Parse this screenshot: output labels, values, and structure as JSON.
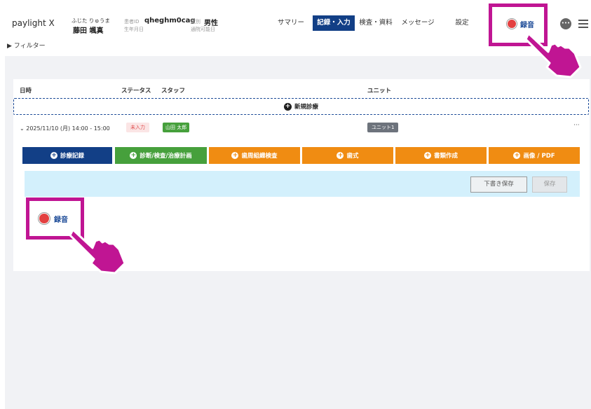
{
  "header": {
    "logo": "paylight X",
    "patient_kana": "ふじた りゅうま",
    "patient_name": "藤田 颯真",
    "patient_id_label": "患者ID",
    "patient_id": "qheghm0cag",
    "birth_label": "生年月日",
    "sex_label": "性別",
    "sex": "男性",
    "visit_label": "通院可能日"
  },
  "nav": {
    "items": [
      "サマリー",
      "記録・入力",
      "検査・資料",
      "メッセージ",
      "設定"
    ],
    "active": "記録・入力"
  },
  "record": {
    "label": "録音",
    "dot_color": "#e34040"
  },
  "more_icon": "ellipsis-icon",
  "menu_icon": "hamburger-menu-icon",
  "filter": {
    "label": "フィルター"
  },
  "table": {
    "headers": [
      "日時",
      "ステータス",
      "スタッフ",
      "ユニット"
    ],
    "new_diagnosis": "新規診療",
    "row": {
      "datetime": "2025/11/10 (月) 14:00 - 15:00",
      "status": "未入力",
      "staff": "山田 太郎",
      "unit": "ユニット1",
      "more": "···"
    }
  },
  "actions": [
    {
      "label": "診療記録",
      "color": "#123f86"
    },
    {
      "label": "診断/検査/治療計画",
      "color": "#46a03c"
    },
    {
      "label": "歯周組織検査",
      "color": "#f08c12"
    },
    {
      "label": "歯式",
      "color": "#f08c12"
    },
    {
      "label": "書類作成",
      "color": "#f08c12"
    },
    {
      "label": "画像 / PDF",
      "color": "#f08c12"
    }
  ],
  "save_bar": {
    "draft_label": "下書き保存",
    "save_label": "保存"
  },
  "annotation_color": "#c01593"
}
